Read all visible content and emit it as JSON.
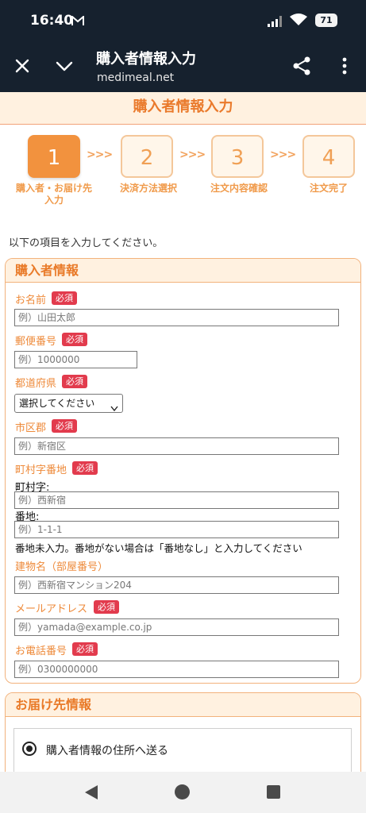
{
  "status": {
    "time": "16:40",
    "battery": "71"
  },
  "app_bar": {
    "title": "購入者情報入力",
    "url": "medimeal.net"
  },
  "page_header": "購入者情報入力",
  "steps": [
    {
      "number": "1",
      "label": "購入者・お届け先\n入力"
    },
    {
      "number": "2",
      "label": "決済方法選択"
    },
    {
      "number": "3",
      "label": "注文内容確認"
    },
    {
      "number": "4",
      "label": "注文完了"
    }
  ],
  "step_arrow": ">>>",
  "intro": "以下の項目を入力してください。",
  "buyer": {
    "title": "購入者情報",
    "required": "必須",
    "name_label": "お名前",
    "name_placeholder": "例）山田太郎",
    "zip_label": "郵便番号",
    "zip_placeholder": "例）1000000",
    "pref_label": "都道府県",
    "pref_select": "選択してください",
    "city_label": "市区郡",
    "city_placeholder": "例）新宿区",
    "town_label": "町村字番地",
    "town_sub": "町村字:",
    "town_placeholder": "例）西新宿",
    "banchi_sub": "番地:",
    "banchi_placeholder": "例）1-1-1",
    "banchi_note": "番地未入力。番地がない場合は「番地なし」と入力してください",
    "building_label": "建物名（部屋番号）",
    "building_placeholder": "例）西新宿マンション204",
    "email_label": "メールアドレス",
    "email_placeholder": "例）yamada@example.co.jp",
    "phone_label": "お電話番号",
    "phone_placeholder": "例）0300000000"
  },
  "delivery": {
    "title": "お届け先情報",
    "option_label": "購入者情報の住所へ送る"
  }
}
